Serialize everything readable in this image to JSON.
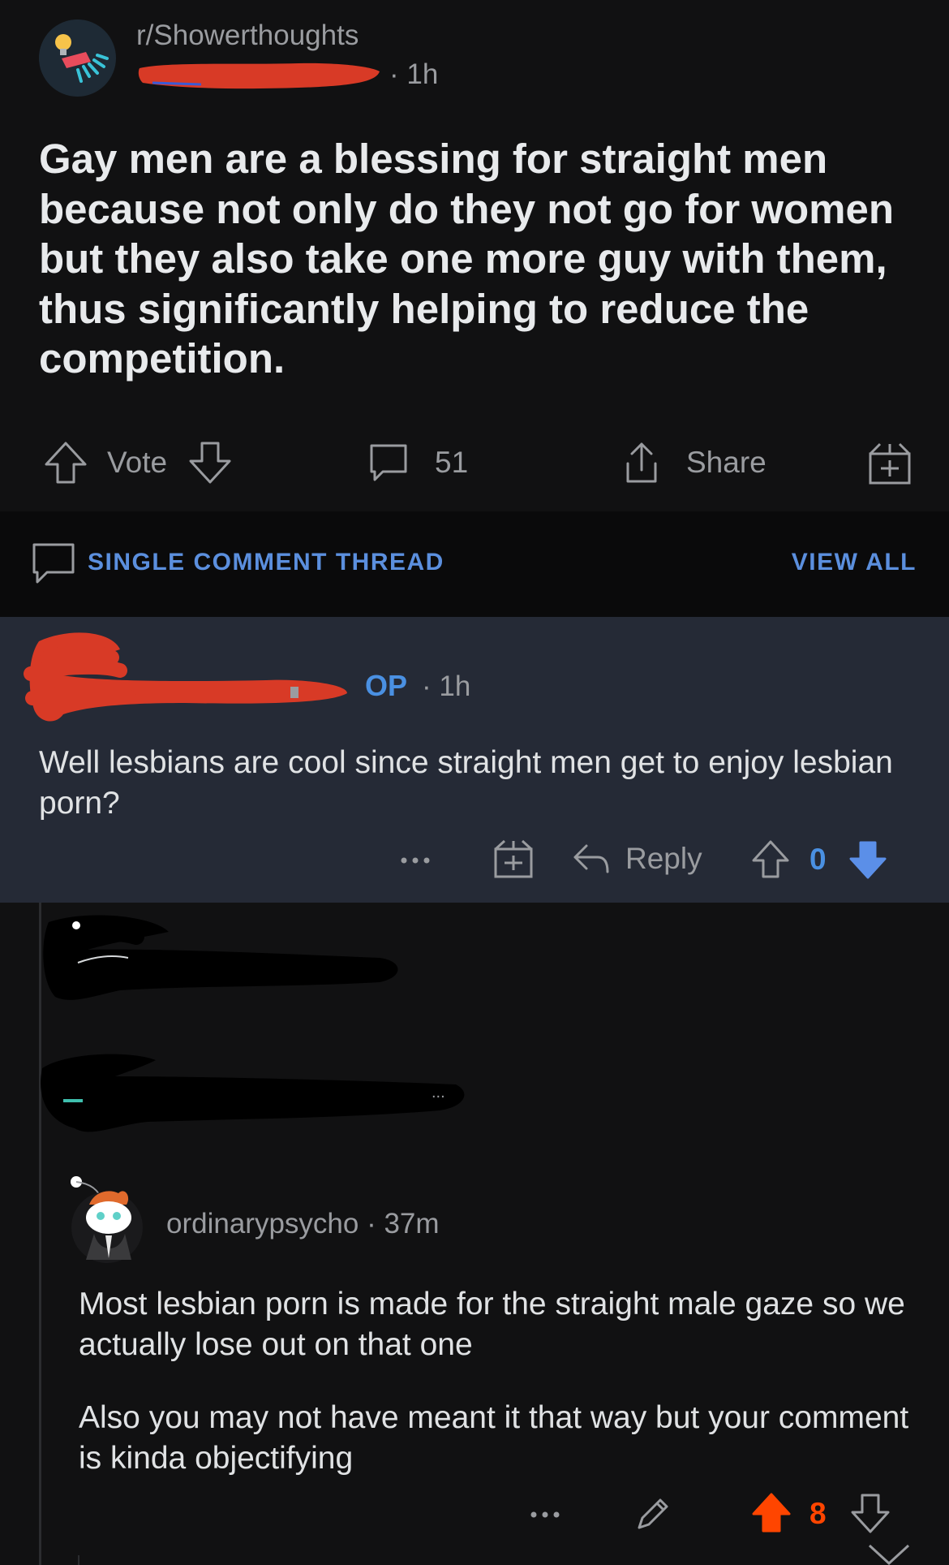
{
  "post": {
    "subreddit": "r/Showerthoughts",
    "time": "1h",
    "title": "Gay men are a blessing for straight men because not only do they not go for women but they also take one more guy with them, thus significantly helping to reduce the competition.",
    "vote_label": "Vote",
    "comment_count": "51",
    "share_label": "Share"
  },
  "thread_bar": {
    "title": "SINGLE COMMENT THREAD",
    "view_all": "VIEW ALL"
  },
  "comment1": {
    "op_badge": "OP",
    "time": "1h",
    "body": "Well lesbians are cool since straight men get to enjoy lesbian porn?",
    "reply_label": "Reply",
    "score": "0"
  },
  "comment2": {
    "username": "ordinarypsycho",
    "time": "37m",
    "paragraph1": "Most lesbian porn is made for the straight male gaze so we actually lose out on that one",
    "paragraph2": "Also you may not have meant it that way but your comment is kinda objectifying",
    "score": "8"
  },
  "colors": {
    "accent_blue": "#4a90e2",
    "upvote_orange": "#ff4500",
    "redaction_red": "#d83a26"
  },
  "icons": {
    "subreddit": "lightbulb-shower-icon",
    "upvote": "arrow-up-icon",
    "downvote": "arrow-down-icon",
    "comments": "speech-bubble-icon",
    "share": "share-icon",
    "award": "gift-icon",
    "reply": "reply-arrow-icon",
    "more": "ellipsis-icon",
    "edit": "pencil-icon"
  }
}
